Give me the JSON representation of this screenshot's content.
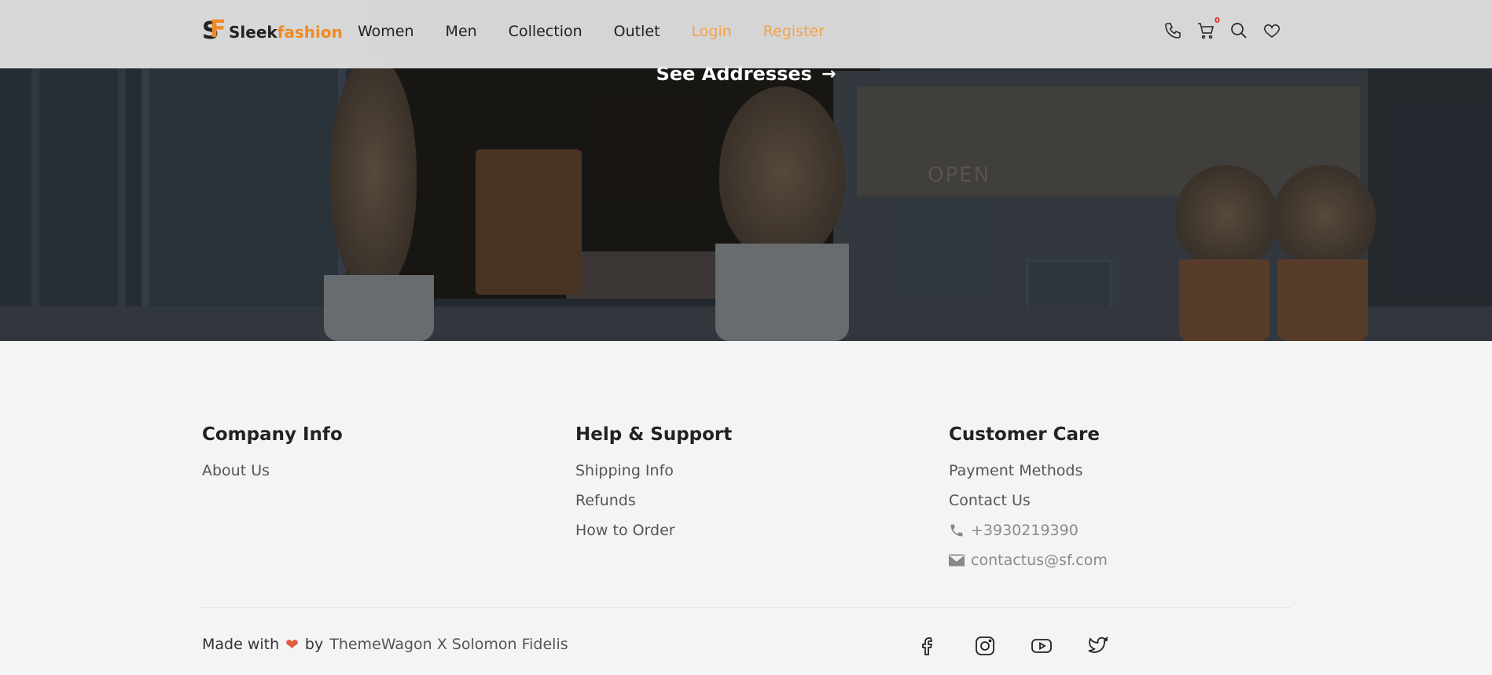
{
  "brand": {
    "name_part1": "Sleek",
    "name_part2": "fashion",
    "mark_s": "S",
    "mark_f": "F",
    "accent_color": "#f08a24"
  },
  "nav": {
    "items": [
      "Women",
      "Men",
      "Collection",
      "Outlet"
    ],
    "login": "Login",
    "register": "Register"
  },
  "header_icons": [
    "phone-icon",
    "cart-icon",
    "search-icon",
    "heart-icon"
  ],
  "cart": {
    "count": "0"
  },
  "hero": {
    "cta": "See Addresses",
    "cta_arrow": "→",
    "sign_text": "OPEN"
  },
  "footer": {
    "company": {
      "title": "Company Info",
      "links": [
        "About Us"
      ]
    },
    "help": {
      "title": "Help & Support",
      "links": [
        "Shipping Info",
        "Refunds",
        "How to Order"
      ]
    },
    "care": {
      "title": "Customer Care",
      "links": [
        "Payment Methods",
        "Contact Us"
      ],
      "phone": "+3930219390",
      "email": "contactus@sf.com"
    },
    "made_with": "Made with",
    "by": "by",
    "credit": "ThemeWagon X Solomon Fidelis",
    "socials": [
      "facebook-icon",
      "instagram-icon",
      "youtube-icon",
      "twitter-icon"
    ]
  }
}
